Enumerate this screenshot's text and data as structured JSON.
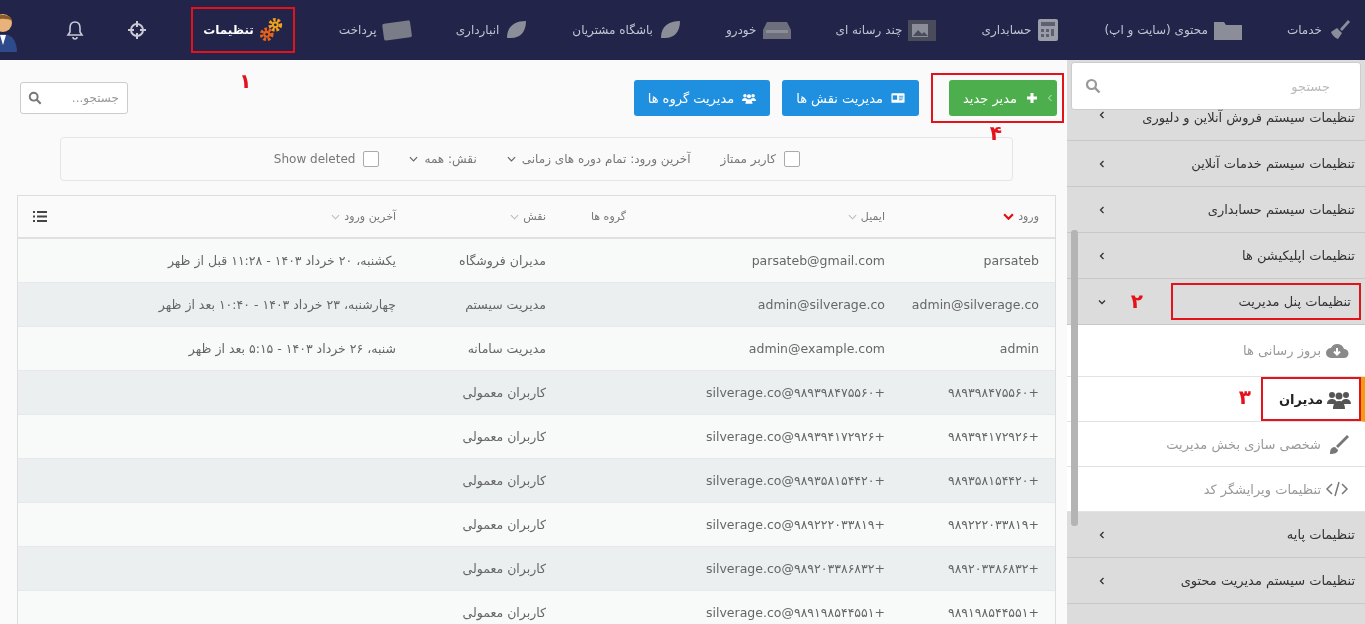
{
  "top_nav": {
    "items": [
      {
        "label": "خدمات",
        "selected": false
      },
      {
        "label": "محتوی (سایت و اپ)",
        "selected": false
      },
      {
        "label": "حسابداری",
        "selected": false
      },
      {
        "label": "چند رسانه ای",
        "selected": false
      },
      {
        "label": "خودرو",
        "selected": false
      },
      {
        "label": "باشگاه مشتریان",
        "selected": false
      },
      {
        "label": "انبارداری",
        "selected": false
      },
      {
        "label": "پرداخت",
        "selected": false
      },
      {
        "label": "تنظیمات",
        "selected": true,
        "callout": "۱"
      }
    ]
  },
  "sidebar": {
    "search": {
      "placeholder": "جستجو"
    },
    "items": [
      {
        "label": "تنظیمات سیستم فروش آنلاین و دلیوری",
        "expanded": false
      },
      {
        "label": "تنظیمات سیستم خدمات آنلاین",
        "expanded": false
      },
      {
        "label": "تنظیمات سیستم حسابداری",
        "expanded": false
      },
      {
        "label": "تنظیمات اپلیکیشن ها",
        "expanded": false
      },
      {
        "label": "تنظیمات پنل مدیریت",
        "expanded": true,
        "callout": "۲",
        "children": [
          {
            "label": "بروز رسانی ها",
            "selected": false
          },
          {
            "label": "مدیران",
            "selected": true,
            "callout": "۳"
          },
          {
            "label": "شخصی سازی بخش مدیریت",
            "selected": false
          },
          {
            "label": "تنظیمات ویرایشگر کد",
            "selected": false
          }
        ]
      },
      {
        "label": "تنظیمات پایه",
        "expanded": false
      },
      {
        "label": "تنظیمات سیستم مدیریت محتوی",
        "expanded": false
      }
    ]
  },
  "toolbar": {
    "buttons": [
      {
        "label": "مدیر جدید",
        "kind": "primary",
        "callout": "۴"
      },
      {
        "label": "مدیریت نقش ها",
        "kind": "secondary"
      },
      {
        "label": "مدیریت گروه ها",
        "kind": "secondary"
      }
    ],
    "search": {
      "placeholder": "جستجو..."
    }
  },
  "filters": {
    "premium": {
      "label": "کاربر ممتاز",
      "checked": false
    },
    "last_login": {
      "label": "آخرین ورود:",
      "value": "تمام دوره های زمانی"
    },
    "role": {
      "label": "نقش:",
      "value": "همه"
    },
    "show_deleted": {
      "label": "Show deleted",
      "checked": false
    }
  },
  "table": {
    "columns": [
      {
        "label": "ورود",
        "sortable": true,
        "sorted": true
      },
      {
        "label": "ایمیل",
        "sortable": true,
        "sorted": false
      },
      {
        "label": "گروه ها",
        "sortable": false
      },
      {
        "label": "نقش",
        "sortable": true,
        "sorted": false
      },
      {
        "label": "آخرین ورود",
        "sortable": true,
        "sorted": false
      }
    ],
    "rows": [
      {
        "login": "parsateb",
        "email": "parsateb@gmail.com",
        "role": "مدیران فروشگاه",
        "last_login": "یکشنبه، ۲۰ خرداد ۱۴۰۳ - ۱۱:۲۸ قبل از ظهر"
      },
      {
        "login": "admin@silverage.co",
        "email": "admin@silverage.co",
        "role": "مدیریت سیستم",
        "last_login": "چهارشنبه، ۲۳ خرداد ۱۴۰۳ - ۱۰:۴۰ بعد از ظهر"
      },
      {
        "login": "admin",
        "email": "admin@example.com",
        "role": "مدیریت سامانه",
        "last_login": "شنبه، ۲۶ خرداد ۱۴۰۳ - ۵:۱۵ بعد از ظهر"
      },
      {
        "login": "+۹۸۹۳۹۸۴۷۵۵۶۰",
        "email": "+۹۸۹۳۹۸۴۷۵۵۶۰@silverage.co",
        "role": "کاربران معمولی"
      },
      {
        "login": "+۹۸۹۳۹۴۱۷۲۹۲۶",
        "email": "+۹۸۹۳۹۴۱۷۲۹۲۶@silverage.co",
        "role": "کاربران معمولی"
      },
      {
        "login": "+۹۸۹۳۵۸۱۵۴۴۲۰",
        "email": "+۹۸۹۳۵۸۱۵۴۴۲۰@silverage.co",
        "role": "کاربران معمولی"
      },
      {
        "login": "+۹۸۹۲۲۲۰۳۳۸۱۹",
        "email": "+۹۸۹۲۲۲۰۳۳۸۱۹@silverage.co",
        "role": "کاربران معمولی"
      },
      {
        "login": "+۹۸۹۲۰۳۳۸۶۸۳۲",
        "email": "+۹۸۹۲۰۳۳۸۶۸۳۲@silverage.co",
        "role": "کاربران معمولی"
      },
      {
        "login": "+۹۸۹۱۹۸۵۴۴۵۵۱",
        "email": "+۹۸۹۱۹۸۵۴۴۵۵۱@silverage.co",
        "role": "کاربران معمولی"
      }
    ]
  }
}
